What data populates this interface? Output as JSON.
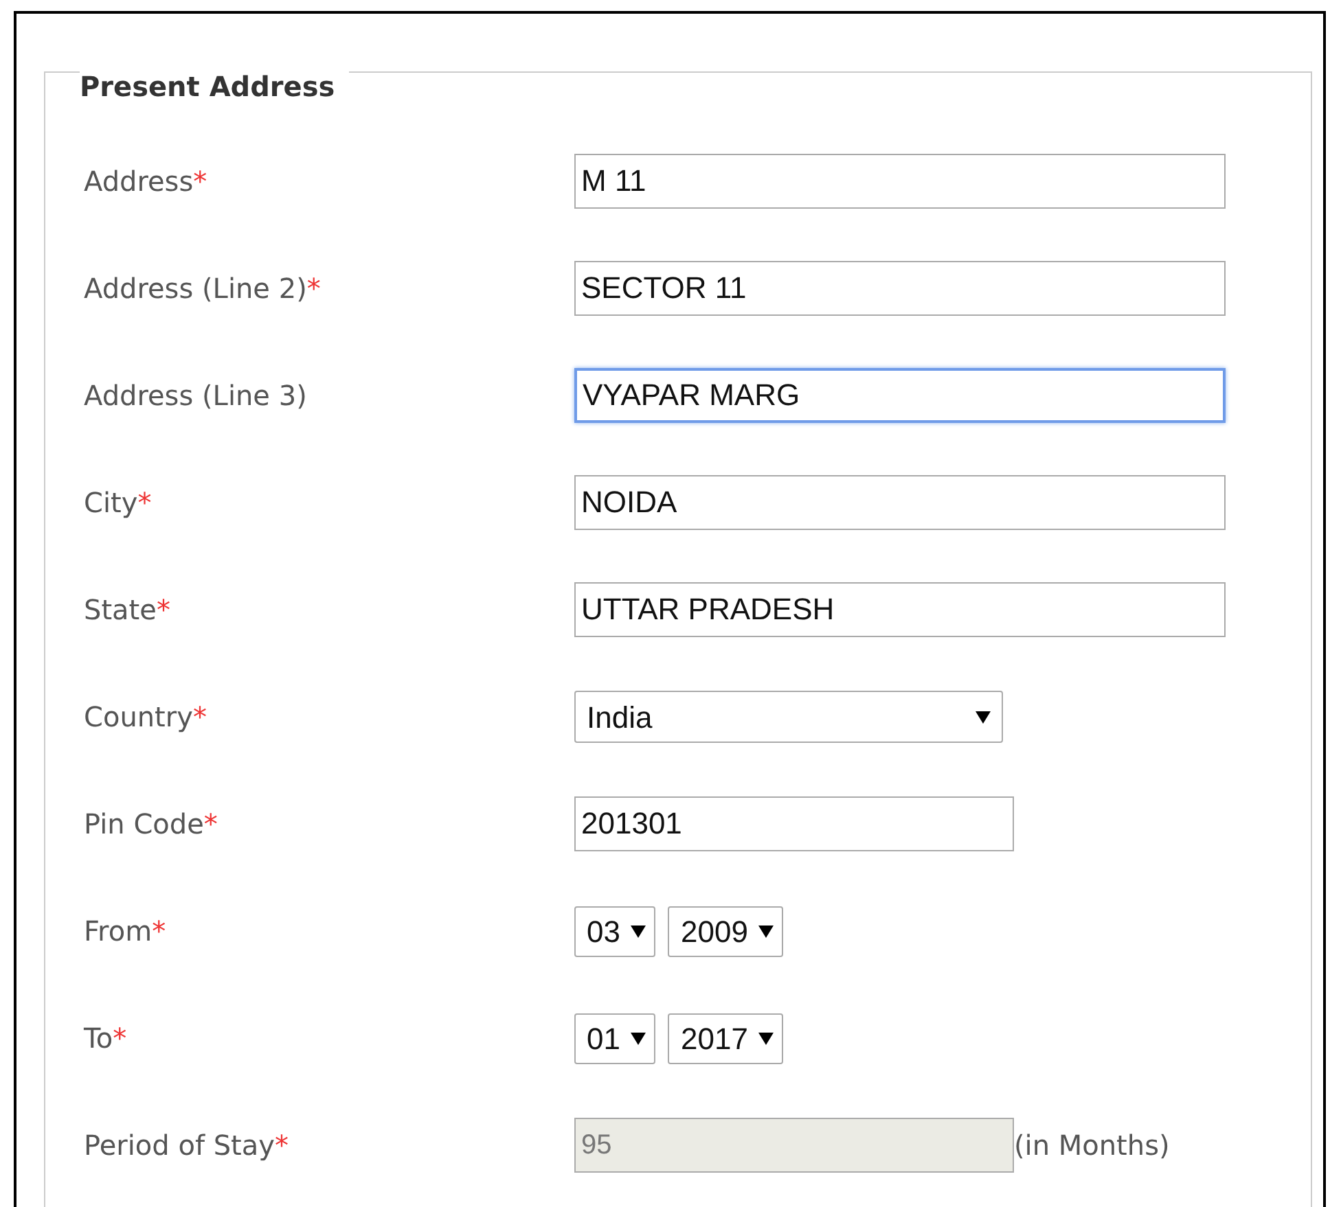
{
  "section": {
    "title": "Present Address"
  },
  "fields": [
    {
      "kind": "text",
      "label": "Address",
      "required_mark": "*",
      "value": "M 11",
      "focused": false
    },
    {
      "kind": "text",
      "label": "Address (Line 2)",
      "required_mark": "*",
      "value": "SECTOR 11",
      "focused": false
    },
    {
      "kind": "text",
      "label": "Address (Line 3)",
      "value": "VYAPAR MARG",
      "focused": true
    },
    {
      "kind": "text",
      "label": "City",
      "required_mark": "*",
      "value": "NOIDA",
      "focused": false
    },
    {
      "kind": "text",
      "label": "State",
      "required_mark": "*",
      "value": "UTTAR PRADESH",
      "focused": false
    },
    {
      "kind": "select",
      "label": "Country",
      "required_mark": "*",
      "value": "India"
    },
    {
      "kind": "short",
      "label": "Pin Code",
      "required_mark": "*",
      "value": "201301",
      "focused": false
    },
    {
      "kind": "date",
      "label": "From",
      "required_mark": "*",
      "parts": [
        "03",
        "2009"
      ]
    },
    {
      "kind": "date",
      "label": "To",
      "required_mark": "*",
      "parts": [
        "01",
        "2017"
      ]
    },
    {
      "kind": "readonly",
      "label": "Period of Stay",
      "required_mark": "*",
      "value": "95",
      "disabled": true,
      "suffix": "(in Months)"
    }
  ]
}
